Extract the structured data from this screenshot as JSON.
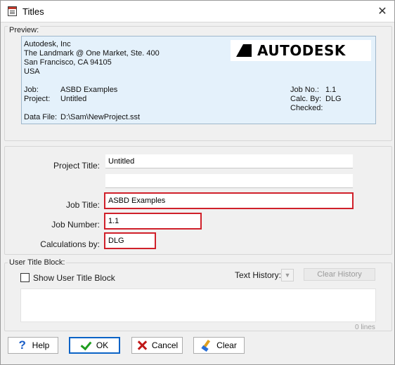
{
  "window": {
    "title": "Titles",
    "close_glyph": "✕"
  },
  "preview": {
    "group_label": "Preview:",
    "address": [
      "Autodesk, Inc",
      "The Landmark @ One Market, Ste. 400",
      "San Francisco, CA 94105",
      "USA"
    ],
    "logo_text": "AUTODESK",
    "job_label": "Job:",
    "job_value": "ASBD Examples",
    "project_label": "Project:",
    "project_value": "Untitled",
    "job_no_label": "Job No.:",
    "job_no_value": "1.1",
    "calc_by_label": "Calc. By:",
    "calc_by_value": "DLG",
    "checked_label": "Checked:",
    "data_file_label": "Data File:",
    "data_file_value": "D:\\Sam\\NewProject.sst"
  },
  "form": {
    "project_title_label": "Project Title:",
    "project_title_value": "Untitled",
    "project_title_line2_value": "",
    "job_title_label": "Job Title:",
    "job_title_value": "ASBD Examples",
    "job_number_label": "Job Number:",
    "job_number_value": "1.1",
    "calculations_by_label": "Calculations by:",
    "calculations_by_value": "DLG",
    "highlight_color": "#d0202a"
  },
  "user_title_block": {
    "group_label": "User Title Block:",
    "show_checkbox_label": "Show User Title Block",
    "show_checked": false,
    "text_history_label": "Text History:",
    "clear_history_label": "Clear History",
    "lines_count": "0 lines"
  },
  "buttons": {
    "help": "Help",
    "ok": "OK",
    "cancel": "Cancel",
    "clear": "Clear"
  },
  "colors": {
    "preview_bg": "#e4f1fb",
    "default_button_border": "#0a63c6"
  }
}
